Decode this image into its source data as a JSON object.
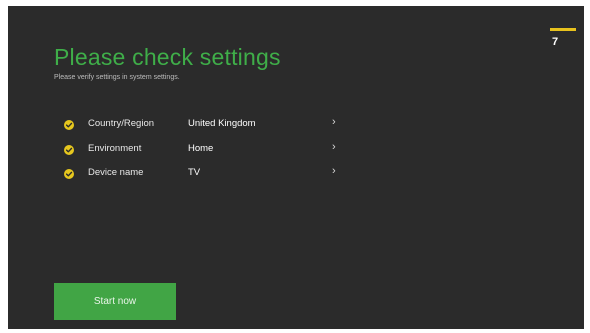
{
  "screen": {
    "title": "Please check settings",
    "subtitle": "Please verify settings in system settings.",
    "step_number": "7"
  },
  "settings": [
    {
      "label": "Country/Region",
      "value": "United Kingdom",
      "icon": "check-icon"
    },
    {
      "label": "Environment",
      "value": "Home",
      "icon": "check-icon"
    },
    {
      "label": "Device name",
      "value": "TV",
      "icon": "check-icon"
    }
  ],
  "chevron_glyph": "›",
  "actions": {
    "start_label": "Start now"
  },
  "colors": {
    "background": "#2b2b2b",
    "title_green": "#3fae49",
    "button_green": "#41a545",
    "check_yellow": "#e6c71e",
    "step_bar_yellow": "#e8c21d"
  }
}
